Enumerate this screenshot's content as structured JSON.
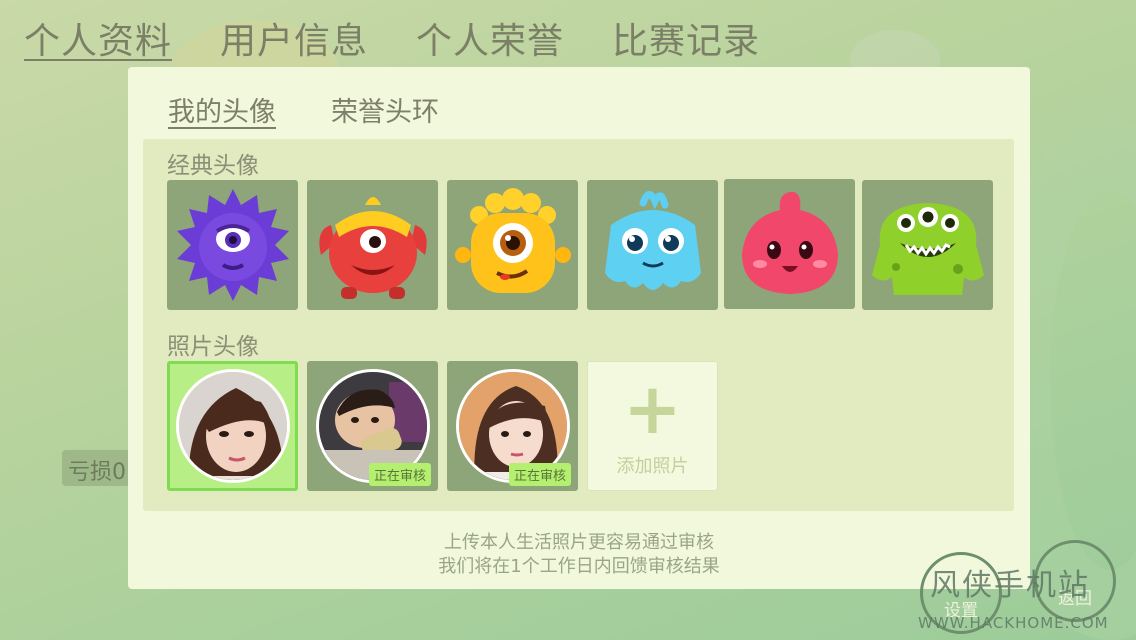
{
  "top_tabs": [
    {
      "label": "个人资料",
      "active": true
    },
    {
      "label": "用户信息",
      "active": false
    },
    {
      "label": "个人荣誉",
      "active": false
    },
    {
      "label": "比赛记录",
      "active": false
    }
  ],
  "side_stub": "亏损0",
  "panel": {
    "sub_tabs": [
      {
        "label": "我的头像",
        "active": true
      },
      {
        "label": "荣誉头环",
        "active": false
      }
    ],
    "classic_title": "经典头像",
    "classic_avatars": [
      {
        "icon": "purple-spiky-monster-icon",
        "color": "#6d3fd6"
      },
      {
        "icon": "red-horned-monster-icon",
        "color": "#e23a3a"
      },
      {
        "icon": "yellow-one-eyed-monster-icon",
        "color": "#ffc21a"
      },
      {
        "icon": "blue-fluffy-monster-icon",
        "color": "#5ed0f2"
      },
      {
        "icon": "pink-drop-monster-icon",
        "color": "#f0476a"
      },
      {
        "icon": "green-three-eyed-monster-icon",
        "color": "#8fd12a"
      }
    ],
    "photo_title": "照片头像",
    "photo_avatars": [
      {
        "icon": "woman-photo",
        "selected": true,
        "badge": ""
      },
      {
        "icon": "baby-photo",
        "selected": false,
        "badge": "正在审核"
      },
      {
        "icon": "girl-photo",
        "selected": false,
        "badge": "正在审核"
      }
    ],
    "add_photo_label": "添加照片",
    "hint_line1": "上传本人生活照片更容易通过审核",
    "hint_line2": "我们将在1个工作日内回馈审核结果"
  },
  "corner_buttons": {
    "settings_label": "设置",
    "back_label": "返回"
  },
  "watermark": {
    "text": "风侠手机站",
    "url": "WWW.HACKHOME.COM"
  }
}
